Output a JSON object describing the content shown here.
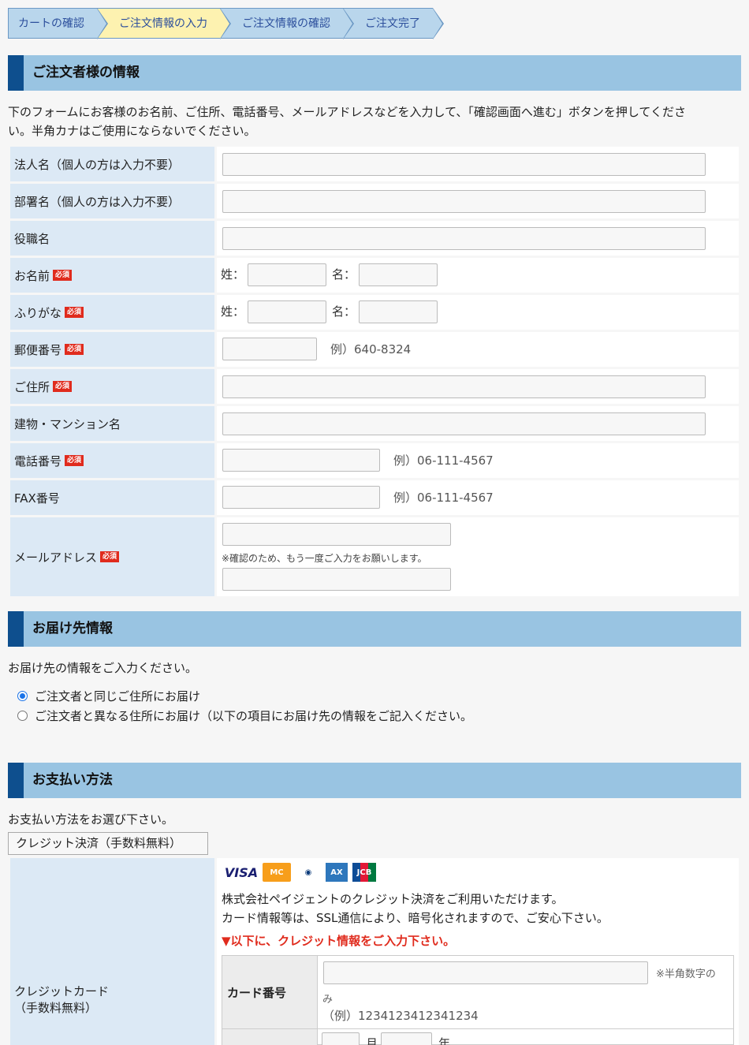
{
  "steps": [
    "カートの確認",
    "ご注文情報の入力",
    "ご注文情報の確認",
    "ご注文完了"
  ],
  "orderer": {
    "heading": "ご注文者様の情報",
    "intro": "下のフォームにお客様のお名前、ご住所、電話番号、メールアドレスなどを入力して、「確認画面へ進む」ボタンを押してくださ",
    "intro2": "い。半角カナはご使用にならないでください。",
    "required": "必須",
    "rows": {
      "company": "法人名（個人の方は入力不要）",
      "dept": "部署名（個人の方は入力不要）",
      "title": "役職名",
      "name": "お名前",
      "kana": "ふりがな",
      "zip": "郵便番号",
      "address": "ご住所",
      "building": "建物・マンション名",
      "tel": "電話番号",
      "fax": "FAX番号",
      "email": "メールアドレス"
    },
    "sei": "姓：",
    "mei": "名：",
    "zip_example": "例）640-8324",
    "tel_example": "例）06-111-4567",
    "fax_example": "例）06-111-4567",
    "email_confirm_note": "※確認のため、もう一度ご入力をお願いします。"
  },
  "delivery": {
    "heading": "お届け先情報",
    "intro": "お届け先の情報をご入力ください。",
    "option_same": "ご注文者と同じご住所にお届け",
    "option_diff": "ご注文者と異なる住所にお届け（以下の項目にお届け先の情報をご記入ください。",
    "selected": "option_same"
  },
  "payment": {
    "heading": "お支払い方法",
    "intro": "お支払い方法をお選び下さい。",
    "method_selected": "クレジット決済（手数料無料）",
    "row_label_1": "クレジットカード",
    "row_label_2": "（手数料無料）",
    "brands": [
      "VISA",
      "MasterCard",
      "Diners",
      "AMEX",
      "JCB"
    ],
    "desc1": "株式会社ペイジェントのクレジット決済をご利用いただけます。",
    "desc2": "カード情報等は、SSL通信により、暗号化されますので、ご安心下さい。",
    "notice": "▼以下に、クレジット情報をご入力下さい。",
    "card_number_label": "カード番号",
    "card_number_note1": "※半角数字の",
    "card_number_note2": "み",
    "card_number_example": "（例）1234123412341234",
    "month_label": "月",
    "year_label": "年"
  },
  "colors": {
    "accent": "#0e4f8e",
    "header_bg": "#99c4e2",
    "label_bg": "#dce9f5",
    "required_bg": "#e02b1d"
  }
}
